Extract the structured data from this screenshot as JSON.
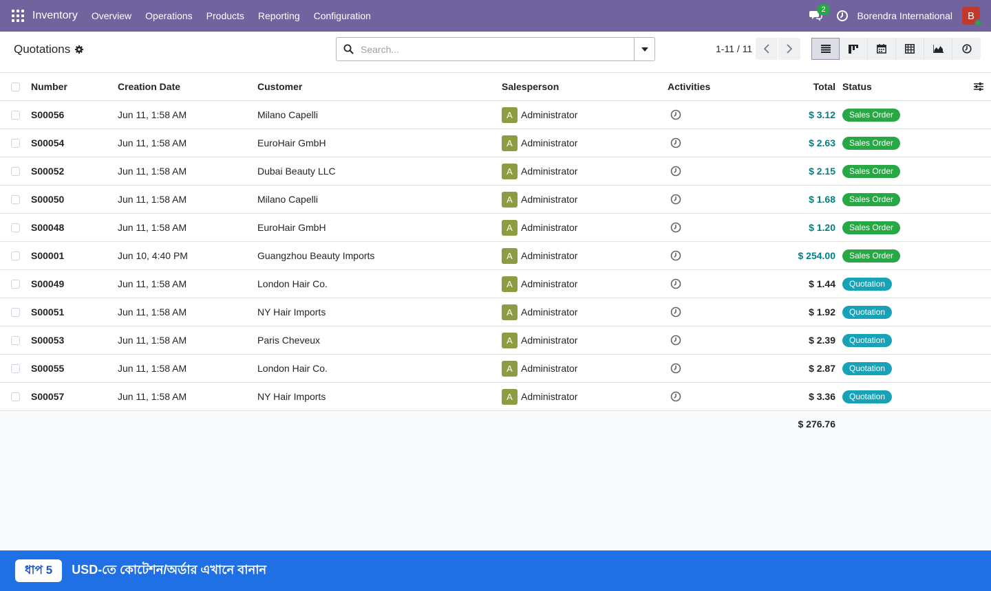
{
  "nav": {
    "app_name": "Inventory",
    "menu": [
      "Overview",
      "Operations",
      "Products",
      "Reporting",
      "Configuration"
    ],
    "chat_count": "2",
    "company": "Borendra International",
    "avatar_letter": "B"
  },
  "control": {
    "title": "Quotations",
    "search_placeholder": "Search...",
    "pager": "1-11 / 11",
    "views": [
      "list-view-icon",
      "kanban-view-icon",
      "calendar-view-icon",
      "pivot-view-icon",
      "graph-view-icon",
      "activity-view-icon"
    ],
    "active_view": "list-view-icon"
  },
  "table": {
    "headers": {
      "number": "Number",
      "date": "Creation Date",
      "customer": "Customer",
      "salesperson": "Salesperson",
      "activities": "Activities",
      "total": "Total",
      "status": "Status"
    },
    "rows": [
      {
        "number": "S00056",
        "date": "Jun 11, 1:58 AM",
        "customer": "Milano Capelli",
        "sp_initial": "A",
        "salesperson": "Administrator",
        "total": "$ 3.12",
        "status": "Sales Order"
      },
      {
        "number": "S00054",
        "date": "Jun 11, 1:58 AM",
        "customer": "EuroHair GmbH",
        "sp_initial": "A",
        "salesperson": "Administrator",
        "total": "$ 2.63",
        "status": "Sales Order"
      },
      {
        "number": "S00052",
        "date": "Jun 11, 1:58 AM",
        "customer": "Dubai Beauty LLC",
        "sp_initial": "A",
        "salesperson": "Administrator",
        "total": "$ 2.15",
        "status": "Sales Order"
      },
      {
        "number": "S00050",
        "date": "Jun 11, 1:58 AM",
        "customer": "Milano Capelli",
        "sp_initial": "A",
        "salesperson": "Administrator",
        "total": "$ 1.68",
        "status": "Sales Order"
      },
      {
        "number": "S00048",
        "date": "Jun 11, 1:58 AM",
        "customer": "EuroHair GmbH",
        "sp_initial": "A",
        "salesperson": "Administrator",
        "total": "$ 1.20",
        "status": "Sales Order"
      },
      {
        "number": "S00001",
        "date": "Jun 10, 4:40 PM",
        "customer": "Guangzhou Beauty Imports",
        "sp_initial": "A",
        "salesperson": "Administrator",
        "total": "$ 254.00",
        "status": "Sales Order"
      },
      {
        "number": "S00049",
        "date": "Jun 11, 1:58 AM",
        "customer": "London Hair Co.",
        "sp_initial": "A",
        "salesperson": "Administrator",
        "total": "$ 1.44",
        "status": "Quotation"
      },
      {
        "number": "S00051",
        "date": "Jun 11, 1:58 AM",
        "customer": "NY Hair Imports",
        "sp_initial": "A",
        "salesperson": "Administrator",
        "total": "$ 1.92",
        "status": "Quotation"
      },
      {
        "number": "S00053",
        "date": "Jun 11, 1:58 AM",
        "customer": "Paris Cheveux",
        "sp_initial": "A",
        "salesperson": "Administrator",
        "total": "$ 2.39",
        "status": "Quotation"
      },
      {
        "number": "S00055",
        "date": "Jun 11, 1:58 AM",
        "customer": "London Hair Co.",
        "sp_initial": "A",
        "salesperson": "Administrator",
        "total": "$ 2.87",
        "status": "Quotation"
      },
      {
        "number": "S00057",
        "date": "Jun 11, 1:58 AM",
        "customer": "NY Hair Imports",
        "sp_initial": "A",
        "salesperson": "Administrator",
        "total": "$ 3.36",
        "status": "Quotation"
      }
    ],
    "grand_total": "$ 276.76"
  },
  "banner": {
    "step": "ধাপ 5",
    "text": "USD-তে কোটেশন/অর্ডার এখানে বানান"
  },
  "colors": {
    "navbar": "#71639e",
    "sales_order_badge": "#28a745",
    "quotation_badge": "#17a2b8",
    "total_highlight": "#017e84",
    "banner": "#1f6fe5"
  }
}
